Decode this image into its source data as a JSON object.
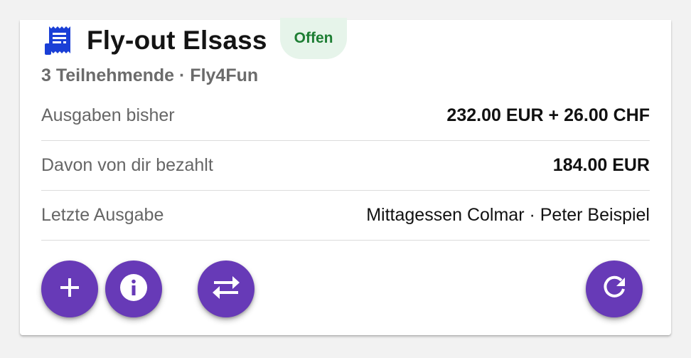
{
  "colors": {
    "accent": "#673ab7",
    "icon_blue": "#1a3fd6",
    "status_bg": "#e6f4ea",
    "status_text": "#1e7e34"
  },
  "header": {
    "icon": "receipt-icon",
    "title": "Fly-out Elsass",
    "status": "Offen"
  },
  "subtitle": "3 Teilnehmende · Fly4Fun",
  "rows": [
    {
      "label": "Ausgaben bisher",
      "value": "232.00 EUR + 26.00 CHF"
    },
    {
      "label": "Davon von dir bezahlt",
      "value": "184.00 EUR"
    },
    {
      "label": "Letzte Ausgabe",
      "value": "Mittagessen Colmar · Peter Beispiel"
    }
  ],
  "actions": {
    "add_icon": "plus-icon",
    "info_icon": "info-icon",
    "transfer_icon": "swap-arrows-icon",
    "refresh_icon": "refresh-icon"
  }
}
